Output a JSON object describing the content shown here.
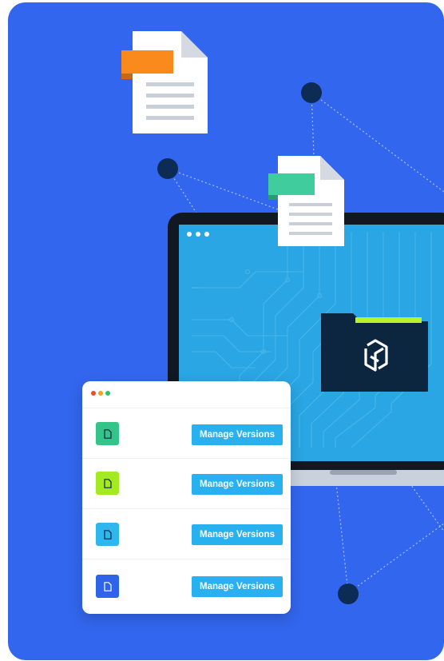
{
  "colors": {
    "background": "#3366ee",
    "screen": "#2aa6e4",
    "button": "#29b1ef",
    "node": "#0d2c55",
    "folder": "#0d2640",
    "folder_tab": "#b9f227",
    "doc_orange": "#fb8a1d",
    "doc_green": "#40cc9c"
  },
  "window_controls": [
    "#ef4a2d",
    "#f6a21e",
    "#2fbf71"
  ],
  "file_list": {
    "rows": [
      {
        "icon": "file-icon",
        "color": "#34c388",
        "button_label": "Manage Versions"
      },
      {
        "icon": "file-icon",
        "color": "#a4ea22",
        "button_label": "Manage Versions"
      },
      {
        "icon": "file-icon",
        "color": "#2eb6ee",
        "button_label": "Manage Versions"
      },
      {
        "icon": "file-icon",
        "color": "#2f63e8",
        "button_label": "Manage Versions"
      }
    ]
  },
  "icons": [
    "document-icon",
    "folder-icon",
    "logo-icon",
    "file-icon",
    "laptop"
  ]
}
